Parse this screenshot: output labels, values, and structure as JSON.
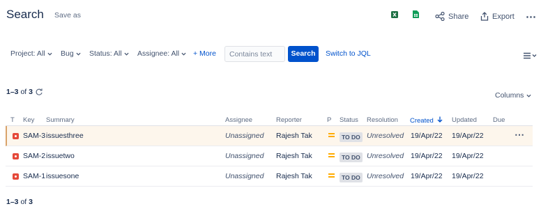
{
  "header": {
    "title": "Search",
    "save_as": "Save as",
    "share_label": "Share",
    "export_label": "Export"
  },
  "filters": {
    "project": "Project: All",
    "type": "Bug",
    "status": "Status: All",
    "assignee": "Assignee: All",
    "more": "+ More",
    "text_placeholder": "Contains text",
    "search_button": "Search",
    "switch_jql": "Switch to JQL"
  },
  "results": {
    "range": "1–3",
    "of_label": "of",
    "total": "3",
    "columns_label": "Columns"
  },
  "table": {
    "headers": {
      "type": "T",
      "key": "Key",
      "summary": "Summary",
      "assignee": "Assignee",
      "reporter": "Reporter",
      "priority": "P",
      "status": "Status",
      "resolution": "Resolution",
      "created": "Created",
      "updated": "Updated",
      "due": "Due"
    },
    "rows": [
      {
        "key": "SAM-3",
        "summary": "issuesthree",
        "assignee": "Unassigned",
        "reporter": "Rajesh Tak",
        "status": "TO DO",
        "resolution": "Unresolved",
        "created": "19/Apr/22",
        "updated": "19/Apr/22"
      },
      {
        "key": "SAM-2",
        "summary": "issuetwo",
        "assignee": "Unassigned",
        "reporter": "Rajesh Tak",
        "status": "TO DO",
        "resolution": "Unresolved",
        "created": "19/Apr/22",
        "updated": "19/Apr/22"
      },
      {
        "key": "SAM-1",
        "summary": "issuesone",
        "assignee": "Unassigned",
        "reporter": "Rajesh Tak",
        "status": "TO DO",
        "resolution": "Unresolved",
        "created": "19/Apr/22",
        "updated": "19/Apr/22"
      }
    ]
  },
  "footer": {
    "range": "1–3",
    "of_label": "of",
    "total": "3"
  },
  "colors": {
    "accent": "#0052cc",
    "bug": "#e5493a",
    "priority": "#ffab00",
    "excel": "#1d6f42",
    "sheet": "#0f9d58"
  },
  "icons": [
    "excel-icon",
    "google-sheets-icon",
    "share-icon",
    "export-icon",
    "more-icon",
    "refresh-icon",
    "list-view-icon",
    "bug-icon",
    "priority-medium-icon",
    "sort-down-icon",
    "chevron-down-icon"
  ]
}
